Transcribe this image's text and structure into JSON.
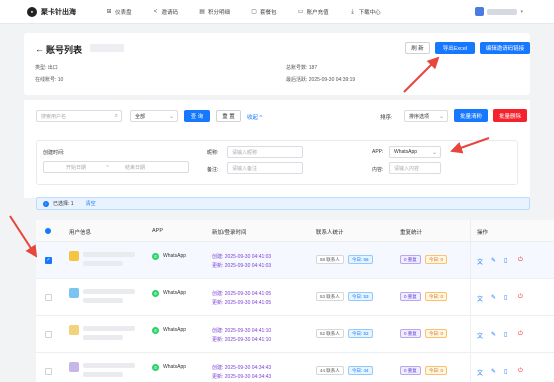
{
  "nav": {
    "brand": "聚卡针出海",
    "items": [
      {
        "label": "仪表盘",
        "icon": "dashboard-icon"
      },
      {
        "label": "邀请码",
        "icon": "share-icon"
      },
      {
        "label": "积分明细",
        "icon": "list-icon"
      },
      {
        "label": "套餐包",
        "icon": "package-icon"
      },
      {
        "label": "账户充值",
        "icon": "wallet-icon"
      },
      {
        "label": "下载中心",
        "icon": "download-icon"
      }
    ]
  },
  "header": {
    "title": "账号列表",
    "type_label": "类型: 出口",
    "online_label": "在线账号: 10",
    "total_label": "总账号数: 187",
    "last_login_label": "最后活跃: 2025-09-30 04:39:19",
    "refresh": "刷 新",
    "export": "导出Excel",
    "fix": "编辑邀请码链接"
  },
  "filters": {
    "search_placeholder": "搜索用户名",
    "all_select": "全部",
    "query": "查 询",
    "reset": "重 置",
    "collapse": "收起 ^",
    "sort_label": "排序:",
    "sort_select": "排序选项",
    "batch_clean": "批量清粉",
    "batch_delete": "批量删除",
    "created_time_label": "创建时间:",
    "start_date": "开始日期",
    "to": "~",
    "end_date": "结束日期",
    "nickname_label": "昵称:",
    "nickname_placeholder": "请输入昵称",
    "remark_label": "备注:",
    "remark_placeholder": "请输入备注",
    "app_label": "APP:",
    "app_value": "WhatsApp",
    "content_label": "内容:",
    "content_placeholder": "请输入内容"
  },
  "selection": {
    "text": "已选择: 1",
    "clear": "清空"
  },
  "table": {
    "headers": [
      "用户信息",
      "APP",
      "新加/登录时间",
      "联系人统计",
      "重复统计",
      "操作"
    ],
    "rows": [
      {
        "app": "WhatsApp",
        "created": "创建: 2025-09-30 04:41:03",
        "updated": "更新: 2025-09-30 04:41:03",
        "contacts": "58 联系人",
        "today": "今日: 58",
        "dup": "0 重复",
        "dup_today": "今日: 0",
        "checked": true,
        "avatar_color": "#f4c542"
      },
      {
        "app": "WhatsApp",
        "created": "创建: 2025-09-30 04:41:05",
        "updated": "更新: 2025-09-30 04:41:05",
        "contacts": "53 联系人",
        "today": "今日: 53",
        "dup": "0 重复",
        "dup_today": "今日: 0",
        "checked": false,
        "avatar_color": "#7cc4f0"
      },
      {
        "app": "WhatsApp",
        "created": "创建: 2025-09-30 04:41:10",
        "updated": "更新: 2025-09-30 04:41:10",
        "contacts": "52 联系人",
        "today": "今日: 52",
        "dup": "0 重复",
        "dup_today": "今日: 0",
        "checked": false,
        "avatar_color": "#f2d27a"
      },
      {
        "app": "WhatsApp",
        "created": "创建: 2025-09-30 04:34:43",
        "updated": "更新: 2025-09-30 04:34:43",
        "contacts": "44 联系人",
        "today": "今日: 44",
        "dup": "0 重复",
        "dup_today": "今日: 0",
        "checked": false,
        "avatar_color": "#c9b6e8"
      }
    ]
  },
  "colors": {
    "primary": "#1677ff",
    "danger": "#f5222d",
    "annotation": "#e8453c",
    "whatsapp": "#25d366"
  }
}
